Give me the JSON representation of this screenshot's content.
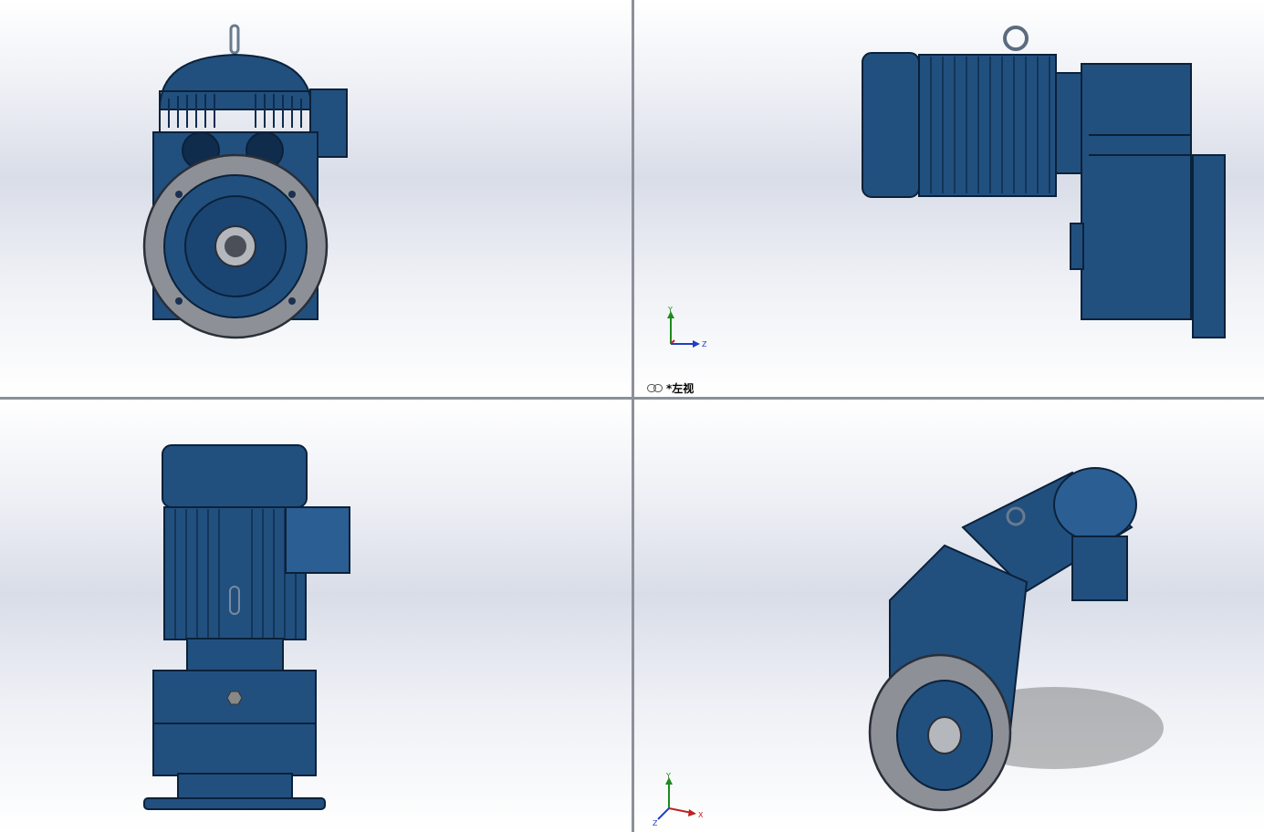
{
  "viewports": [
    {
      "id": "front",
      "label": ""
    },
    {
      "id": "left",
      "label": "*左视"
    },
    {
      "id": "top",
      "label": ""
    },
    {
      "id": "iso",
      "label": ""
    }
  ],
  "triad_axes": {
    "x": "X",
    "y": "Y",
    "z": "Z"
  },
  "colors": {
    "body": "#21507f",
    "dark": "#0f2c4c",
    "light": "#4f7bab",
    "flange": "#8d9096",
    "flange_light": "#b4b7bc"
  }
}
